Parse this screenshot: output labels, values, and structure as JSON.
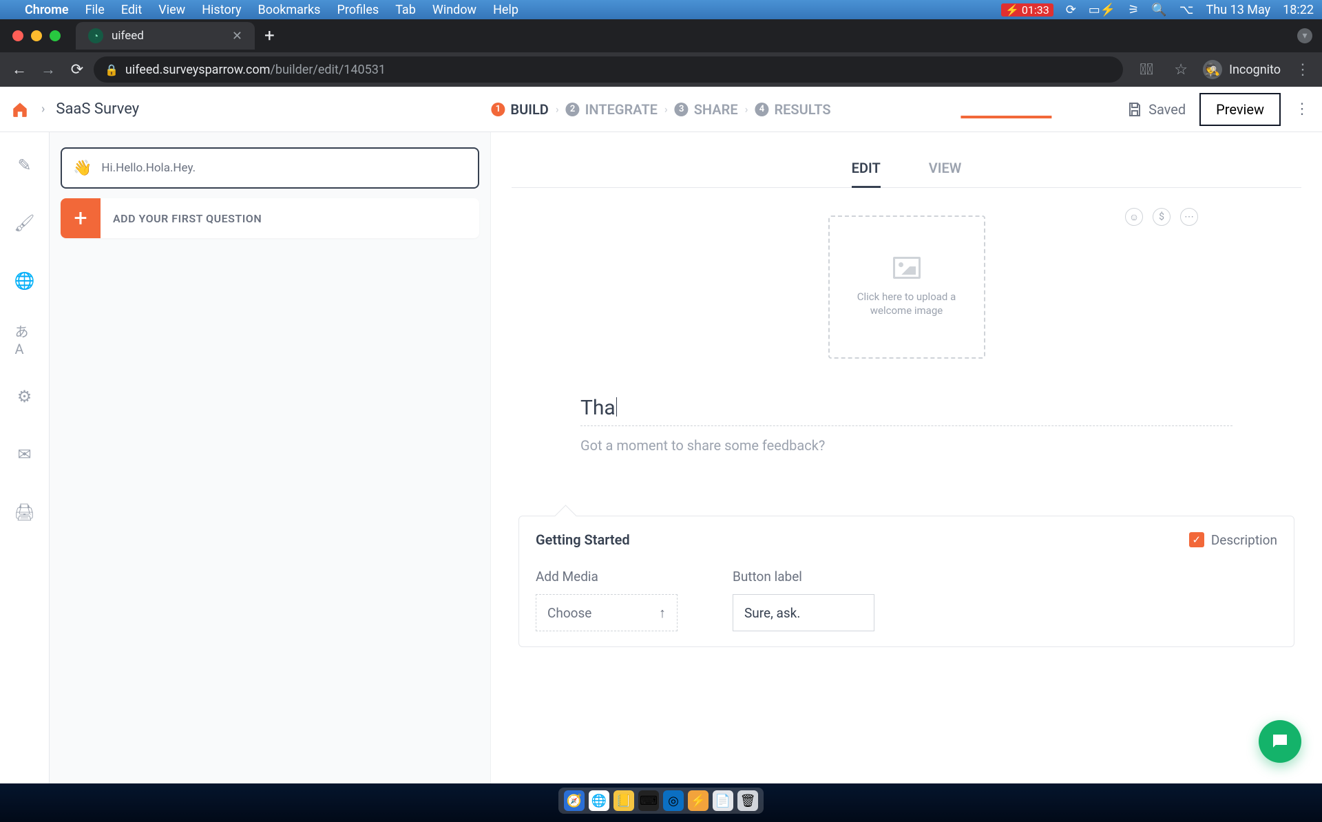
{
  "menubar": {
    "app": "Chrome",
    "items": [
      "File",
      "Edit",
      "View",
      "History",
      "Bookmarks",
      "Profiles",
      "Tab",
      "Window",
      "Help"
    ],
    "battery_time": "01:33",
    "date": "Thu 13 May",
    "time": "18:22"
  },
  "browser": {
    "tab_title": "uifeed",
    "url_host": "uifeed.surveysparrow.com",
    "url_path": "/builder/edit/140531",
    "incognito": "Incognito"
  },
  "header": {
    "survey_name": "SaaS Survey",
    "steps": [
      {
        "num": "1",
        "label": "BUILD"
      },
      {
        "num": "2",
        "label": "INTEGRATE"
      },
      {
        "num": "3",
        "label": "SHARE"
      },
      {
        "num": "4",
        "label": "RESULTS"
      }
    ],
    "saved_label": "Saved",
    "preview_label": "Preview"
  },
  "left_panel": {
    "welcome_text": "Hi.Hello.Hola.Hey.",
    "add_question": "ADD YOUR FIRST QUESTION"
  },
  "canvas": {
    "edit_tab": "EDIT",
    "view_tab": "VIEW",
    "upload_text": "Click here to upload a welcome image",
    "heading_text": "Tha",
    "subhead_text": "Got a moment to share some feedback?"
  },
  "settings": {
    "title": "Getting Started",
    "description_label": "Description",
    "add_media_label": "Add Media",
    "choose_label": "Choose",
    "button_label_label": "Button label",
    "button_label_value": "Sure, ask."
  },
  "corner_icons": {
    "smile": "☺",
    "dollar": "$",
    "more": "⋯"
  }
}
